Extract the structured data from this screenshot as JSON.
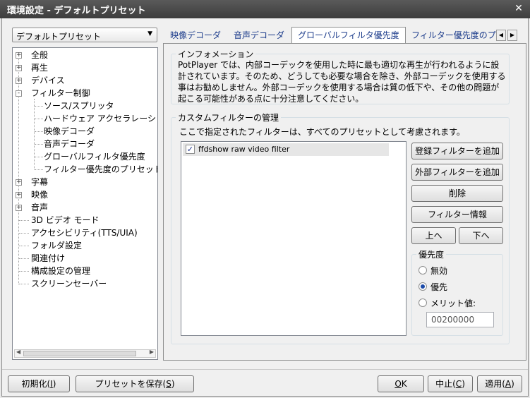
{
  "window": {
    "title": "環境設定 - デフォルトプリセット",
    "close_glyph": "✕"
  },
  "preset": {
    "selected": "デフォルトプリセット"
  },
  "tree": {
    "items": [
      {
        "label": "全般",
        "toggle": "+"
      },
      {
        "label": "再生",
        "toggle": "+"
      },
      {
        "label": "デバイス",
        "toggle": "+"
      },
      {
        "label": "フィルター制御",
        "toggle": "-"
      },
      {
        "label": "ソース/スプリッタ"
      },
      {
        "label": "ハードウェア アクセラレーション"
      },
      {
        "label": "映像デコーダ"
      },
      {
        "label": "音声デコーダ"
      },
      {
        "label": "グローバルフィルタ優先度"
      },
      {
        "label": "フィルター優先度のプリセット"
      },
      {
        "label": "字幕",
        "toggle": "+"
      },
      {
        "label": "映像",
        "toggle": "+"
      },
      {
        "label": "音声",
        "toggle": "+"
      },
      {
        "label": "3D ビデオ モード"
      },
      {
        "label": "アクセシビリティ(TTS/UIA)"
      },
      {
        "label": "フォルダ設定"
      },
      {
        "label": "関連付け"
      },
      {
        "label": "構成設定の管理"
      },
      {
        "label": "スクリーンセーバー"
      }
    ]
  },
  "tabs": {
    "items": [
      "映像デコーダ",
      "音声デコーダ",
      "グローバルフィルタ優先度",
      "フィルター優先度のプ"
    ],
    "active_index": 2,
    "scroll_left": "◀",
    "scroll_right": "▶"
  },
  "info": {
    "legend": "インフォメーション",
    "text": "PotPlayer では、内部コーデックを使用した時に最も適切な再生が行われるように設計されています。そのため、どうしても必要な場合を除き、外部コーデックを使用する事はお勧めしません。外部コーデックを使用する場合は質の低下や、その他の問題が起こる可能性がある点に十分注意してください。"
  },
  "custom": {
    "legend": "カスタムフィルターの管理",
    "description": "ここで指定されたフィルターは、すべてのプリセットとして考慮されます。",
    "filters": [
      {
        "name": "ffdshow raw video filter",
        "checked": true
      }
    ],
    "checkmark": "✓",
    "buttons": {
      "add_registered": "登録フィルターを追加",
      "add_external": "外部フィルターを追加",
      "delete": "削除",
      "filter_info": "フィルター情報",
      "up": "上へ",
      "down": "下へ"
    },
    "priority": {
      "legend": "優先度",
      "options": [
        "無効",
        "優先",
        "メリット値:"
      ],
      "selected_index": 1,
      "merit_value": "00200000"
    }
  },
  "footer": {
    "reset": {
      "text": "初期化(",
      "key": "I",
      "close": ")"
    },
    "save_preset": {
      "text": "プリセットを保存(",
      "key": "S",
      "close": ")"
    },
    "ok": {
      "key": "O",
      "rest": "K"
    },
    "cancel": {
      "text": "中止(",
      "key": "C",
      "close": ")"
    },
    "apply": {
      "text": "適用(",
      "key": "A",
      "close": ")"
    }
  }
}
